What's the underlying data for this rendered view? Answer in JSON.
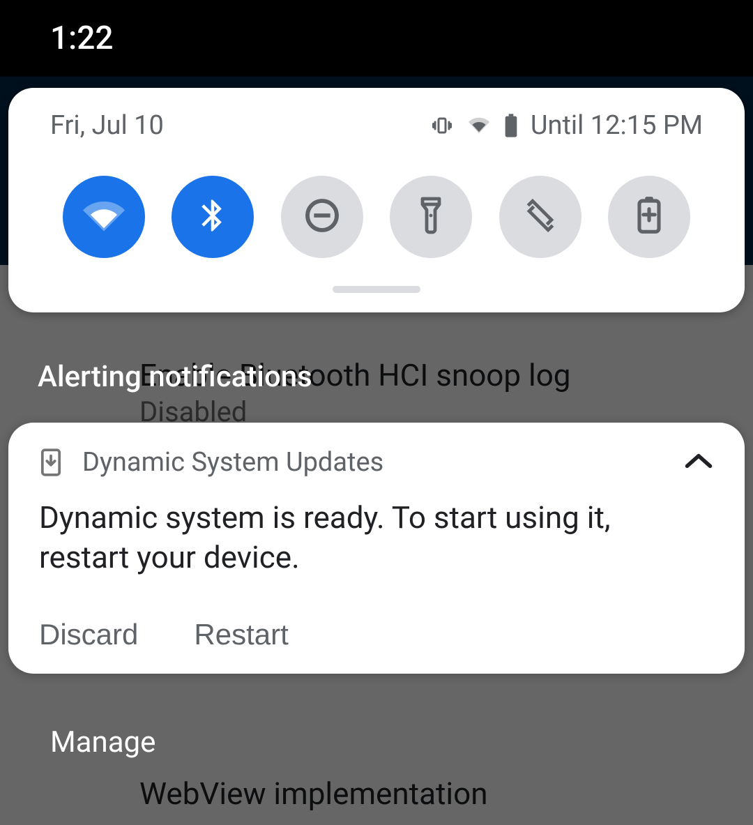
{
  "status_bar": {
    "time": "1:22"
  },
  "qs": {
    "date": "Fri, Jul 10",
    "battery_text": "Until 12:15 PM",
    "tiles": [
      {
        "name": "wifi",
        "active": true
      },
      {
        "name": "bluetooth",
        "active": true
      },
      {
        "name": "dnd",
        "active": false
      },
      {
        "name": "flashlight",
        "active": false
      },
      {
        "name": "auto-rotate",
        "active": false
      },
      {
        "name": "battery-saver",
        "active": false
      }
    ]
  },
  "section_header": "Alerting notifications",
  "notification": {
    "app": "Dynamic System Updates",
    "body": "Dynamic system is ready. To start using it, restart your device.",
    "actions": {
      "discard": "Discard",
      "restart": "Restart"
    }
  },
  "manage": "Manage",
  "background": {
    "item1": {
      "title": "Enable Bluetooth HCI snoop log",
      "sub": "Disabled"
    },
    "item2": {
      "title": "WebView implementation"
    }
  }
}
